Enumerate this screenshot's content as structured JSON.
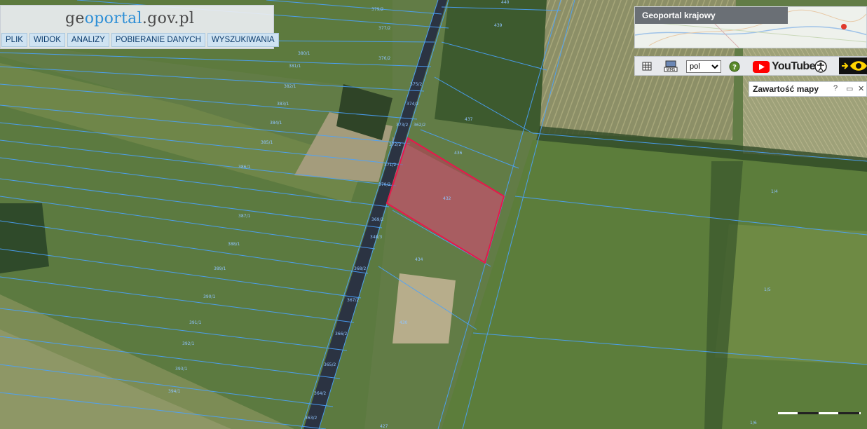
{
  "app": {
    "logo": {
      "prefix": "ge",
      "accent": "oportal",
      "suffix": ".gov.pl"
    },
    "menu": [
      "PLIK",
      "WIDOK",
      "ANALIZY",
      "POBIERANIE DANYCH",
      "WYSZUKIWANIA"
    ]
  },
  "overview_map": {
    "title": "Geoportal krajowy"
  },
  "toolbar": {
    "language": "pol",
    "youtube_label": "YouTube",
    "icons": [
      "table-icon",
      "wms-icon",
      "help-icon",
      "youtube-icon",
      "accessibility-icon",
      "arrow-icon",
      "eye-icon"
    ]
  },
  "layers_panel": {
    "title": "Zawartość mapy",
    "help": "?",
    "minimize": "▭",
    "close": "✕"
  },
  "parcel_labels": [
    "379/2",
    "440",
    "377/2",
    "376/2",
    "380/1",
    "381/1",
    "382/1",
    "383/1",
    "384/1",
    "385/1",
    "386/1",
    "387/1",
    "388/1",
    "389/1",
    "390/1",
    "391/1",
    "392/1",
    "393/1",
    "394/1",
    "375/2",
    "374/2",
    "373/2",
    "372/2",
    "371/2",
    "370/2",
    "369/2",
    "368/2",
    "367/2",
    "366/2",
    "365/2",
    "364/2",
    "363/2",
    "362/2",
    "348/3",
    "439",
    "437",
    "436",
    "432",
    "434",
    "1/4",
    "1/5",
    "1/6",
    "430",
    "427"
  ],
  "colors": {
    "parcel_line": "#4aa3ff",
    "highlight_stroke": "#e8174b",
    "highlight_fill": "#c0395a"
  }
}
